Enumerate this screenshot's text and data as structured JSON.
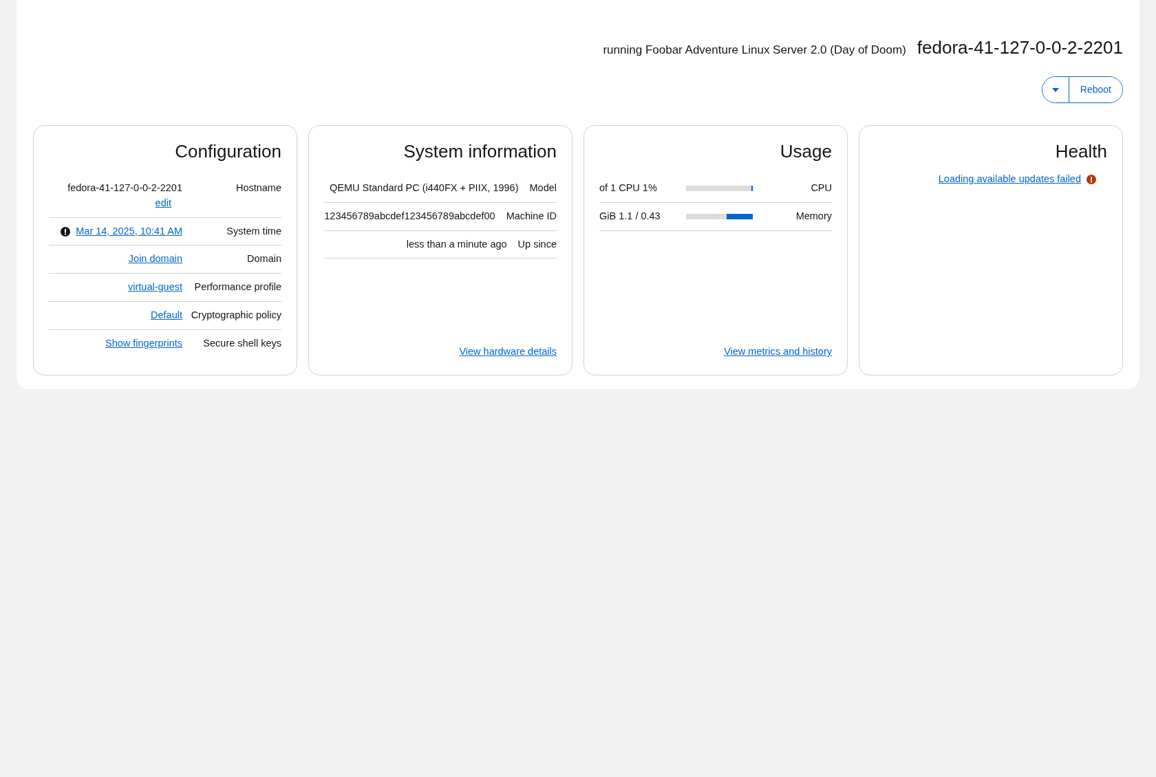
{
  "header": {
    "os": "running Foobar Adventure Linux Server 2.0 (Day of Doom)",
    "hostname": "fedora-41-127-0-0-2-2201"
  },
  "actions": {
    "reboot": "Reboot"
  },
  "configuration": {
    "title": "Configuration",
    "rows": [
      {
        "label": "Hostname",
        "value": "fedora-41-127-0-0-2-2201",
        "link": false,
        "warning": false,
        "action": "edit"
      },
      {
        "label": "System time",
        "value": "Mar 14, 2025, 10:41 AM",
        "link": true,
        "warning": true
      },
      {
        "label": "Domain",
        "value": "Join domain",
        "link": true,
        "warning": false
      },
      {
        "label": "Performance profile",
        "value": "virtual-guest",
        "link": true,
        "warning": false
      },
      {
        "label": "Cryptographic policy",
        "value": "Default",
        "link": true,
        "warning": false
      },
      {
        "label": "Secure shell keys",
        "value": "Show fingerprints",
        "link": true,
        "warning": false
      }
    ]
  },
  "system_information": {
    "title": "System information",
    "rows": [
      {
        "label": "Model",
        "value": "QEMU Standard PC (i440FX + PIIX, 1996)"
      },
      {
        "label": "Machine ID",
        "value": "123456789abcdef123456789abcdef00"
      },
      {
        "label": "Up since",
        "value": "less than a minute ago"
      }
    ],
    "footer_link": "View hardware details"
  },
  "usage": {
    "title": "Usage",
    "rows": [
      {
        "label": "CPU",
        "reading": "of 1 CPU 1%",
        "level": 0.01
      },
      {
        "label": "Memory",
        "reading": "GiB 1.1 / 0.43",
        "level": 0.39
      }
    ],
    "footer_link": "View metrics and history"
  },
  "health": {
    "title": "Health",
    "items": [
      {
        "text": "Loading available updates failed",
        "kind": "error"
      }
    ]
  }
}
